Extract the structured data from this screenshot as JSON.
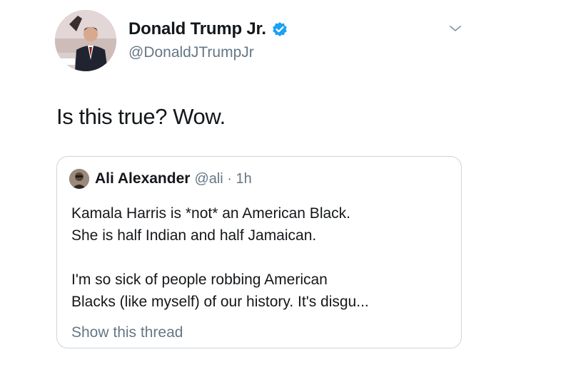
{
  "tweet": {
    "author": {
      "display_name": "Donald Trump Jr.",
      "handle": "@DonaldJTrumpJr",
      "verified": true,
      "avatar_icon": "profile-photo"
    },
    "menu_icon": "chevron-down-icon",
    "text": "Is this true? Wow.",
    "quoted_tweet": {
      "author_name": "Ali Alexander",
      "meta": "@ali · 1h",
      "paragraphs": [
        "Kamala Harris is *not* an American Black.\nShe is half Indian and half Jamaican.",
        "I'm so sick of people robbing American\nBlacks (like myself) of our history. It's disgu..."
      ],
      "show_thread_label": "Show this thread"
    }
  },
  "colors": {
    "text_primary": "#14171a",
    "text_secondary": "#657786",
    "verified_blue": "#1da1f2",
    "border": "#ccd6dd"
  }
}
